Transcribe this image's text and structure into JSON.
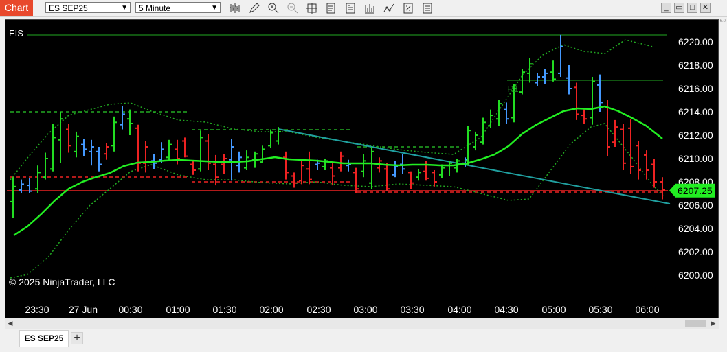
{
  "toolbar": {
    "chart_label": "Chart",
    "instrument": "ES SEP25",
    "interval": "5 Minute",
    "icons": [
      "bar-type-icon",
      "drawing-pencil-icon",
      "zoom-in-icon",
      "zoom-out-icon",
      "crosshair-icon",
      "data-box-icon",
      "properties-icon",
      "indicators-icon",
      "strategies-icon",
      "chart-trader-icon",
      "templates-icon"
    ]
  },
  "window_buttons": {
    "minimize": "_",
    "maximize": "□",
    "restore": "▭",
    "close": "✕"
  },
  "chart": {
    "instrument_label": "EIS",
    "copyright": "© 2025 NinjaTrader, LLC",
    "current_price": "6207.25",
    "r1_label": "R1",
    "price_ticks": [
      "6220.00",
      "6218.00",
      "6216.00",
      "6214.00",
      "6212.00",
      "6210.00",
      "6208.00",
      "6206.00",
      "6204.00",
      "6202.00",
      "6200.00"
    ],
    "time_ticks": [
      "23:30",
      "27 Jun",
      "00:30",
      "01:00",
      "01:30",
      "02:00",
      "02:30",
      "03:00",
      "03:30",
      "04:00",
      "04:30",
      "05:00",
      "05:30",
      "06:00"
    ],
    "colors": {
      "background": "#000000",
      "up": "#22dd22",
      "down": "#ee2222",
      "neutral": "#4499ff",
      "ma": "#22ee22",
      "band": "#22aa22",
      "trend": "#20a0a0",
      "price_line": "#ee2222"
    }
  },
  "tabs": {
    "active": "ES SEP25",
    "add": "+"
  },
  "corner_text": "6.0",
  "chart_data": {
    "type": "candlestick",
    "instrument": "ES SEP25",
    "interval": "5 Minute",
    "ylim": [
      6199.2,
      6221.6
    ],
    "price_ticks": [
      6200,
      6202,
      6204,
      6206,
      6208,
      6210,
      6212,
      6214,
      6216,
      6218,
      6220
    ],
    "time_ticks": [
      "23:30",
      "27 Jun",
      "00:30",
      "01:00",
      "01:30",
      "02:00",
      "02:30",
      "03:00",
      "03:30",
      "04:00",
      "04:30",
      "05:00",
      "05:30",
      "06:00"
    ],
    "last_price": 6207.25,
    "annotations": [
      "R1"
    ]
  }
}
